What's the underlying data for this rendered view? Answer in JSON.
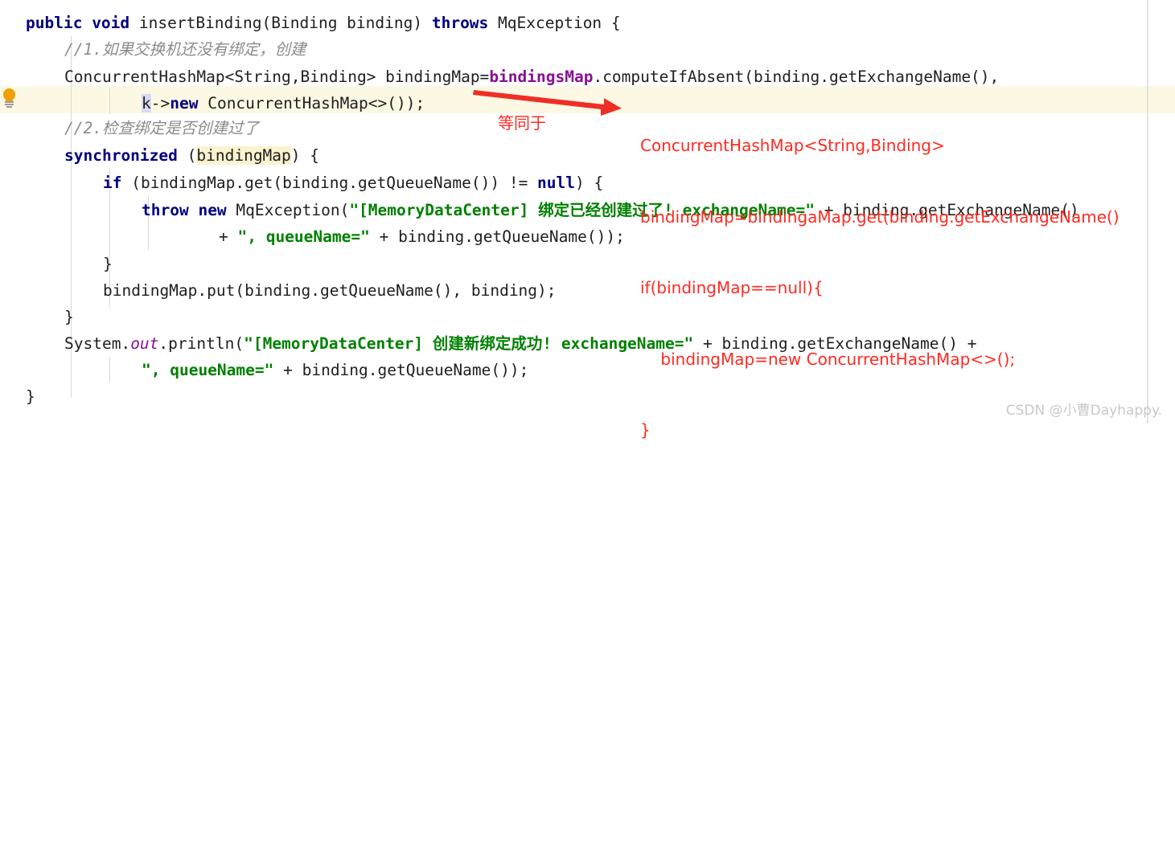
{
  "editor": {
    "gutter_icon": "lightbulb-icon",
    "highlighted_line_number": 4,
    "colors": {
      "keyword": "#000080",
      "string": "#008000",
      "field": "#871094",
      "comment": "#8c8c8c",
      "annotation": "#ff2a22",
      "current_line_background": "#fdf8e3",
      "identifier_highlight": "#fbf2d0",
      "caret_word_highlight": "#dbd9f8"
    },
    "code_lines": [
      {
        "id": "line-1",
        "text": "public void insertBinding(Binding binding) throws MqException {"
      },
      {
        "id": "line-2",
        "text": "//1.如果交换机还没有绑定，创建"
      },
      {
        "id": "line-3",
        "text": "ConcurrentHashMap<String,Binding> bindingMap=bindingsMap.computeIfAbsent(binding.getExchangeName(),"
      },
      {
        "id": "line-4",
        "text": "k->new ConcurrentHashMap<>());"
      },
      {
        "id": "line-5",
        "text": "//2.检查绑定是否创建过了"
      },
      {
        "id": "line-6",
        "text": "synchronized (bindingMap) {"
      },
      {
        "id": "line-7",
        "text": "if (bindingMap.get(binding.getQueueName()) != null) {"
      },
      {
        "id": "line-8",
        "text": "throw new MqException(\"[MemoryDataCenter] 绑定已经创建过了! exchangeName=\" + binding.getExchangeName()"
      },
      {
        "id": "line-9",
        "text": "+ \", queueName=\" + binding.getQueueName());"
      },
      {
        "id": "line-10",
        "text": "}"
      },
      {
        "id": "line-11",
        "text": "bindingMap.put(binding.getQueueName(), binding);"
      },
      {
        "id": "line-12",
        "text": "}"
      },
      {
        "id": "line-13",
        "text": "System.out.println(\"[MemoryDataCenter] 创建新绑定成功! exchangeName=\" + binding.getExchangeName() +"
      },
      {
        "id": "line-14",
        "text": "\", queueName=\" + binding.getQueueName());"
      },
      {
        "id": "line-15",
        "text": "}"
      }
    ],
    "tokens": {
      "l1_public": "public ",
      "l1_void": "void ",
      "l1_sig": "insertBinding(Binding binding) ",
      "l1_throws": "throws ",
      "l1_exc": "MqException {",
      "l2_comment": "//1.如果交换机还没有绑定，创建",
      "l3_a": "ConcurrentHashMap<String,Binding> bindingMap=",
      "l3_field": "bindingsMap",
      "l3_b": ".computeIfAbsent(binding.getExchangeName(),",
      "l4_k": "k",
      "l4_arrow": "->",
      "l4_new": "new",
      "l4_rest": " ConcurrentHashMap<>());",
      "l5_comment": "//2.检查绑定是否创建过了",
      "l6_kw": "synchronized",
      "l6_open": " (",
      "l6_ident": "bindingMap",
      "l6_close": ") {",
      "l7_if": "if",
      "l7_mid": " (bindingMap.get(binding.getQueueName()) != ",
      "l7_null": "null",
      "l7_end": ") {",
      "l8_throw": "throw",
      "l8_sp1": " ",
      "l8_new": "new",
      "l8_mid": " MqException(",
      "l8_str": "\"[MemoryDataCenter] 绑定已经创建过了! exchangeName=\"",
      "l8_end": " + binding.getExchangeName()",
      "l9_plus": "+ ",
      "l9_str": "\", queueName=\"",
      "l9_end": " + binding.getQueueName());",
      "l10_brace": "}",
      "l11_text": "bindingMap.put(binding.getQueueName(), binding);",
      "l12_brace": "}",
      "l13_sys": "System.",
      "l13_out": "out",
      "l13_println": ".println(",
      "l13_str": "\"[MemoryDataCenter] 创建新绑定成功! exchangeName=\"",
      "l13_end": " + binding.getExchangeName() +",
      "l14_str": "\", queueName=\"",
      "l14_end": " + binding.getQueueName());",
      "l15_brace": "}"
    }
  },
  "annotation": {
    "arrow_label": "等同于",
    "lines": [
      "ConcurrentHashMap<String,Binding>",
      "bindingMap=bindingaMap.get(binding.getExchangeName()",
      "if(bindingMap==null){",
      "    bindingMap=new ConcurrentHashMap<>();",
      "}"
    ]
  },
  "watermark": {
    "text": "CSDN @小曹Dayhappy."
  }
}
